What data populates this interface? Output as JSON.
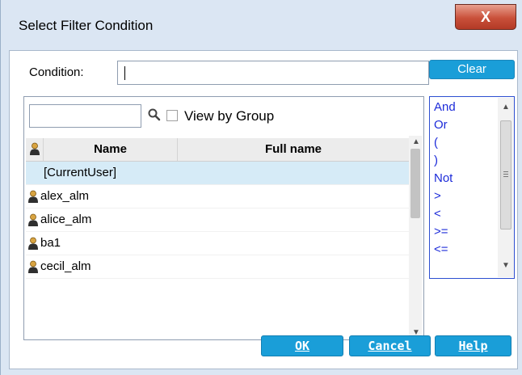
{
  "dialog": {
    "title": "Select Filter Condition",
    "close_glyph": "X"
  },
  "condition": {
    "label": "Condition:",
    "value": "",
    "clear_label": "Clear"
  },
  "users": {
    "search_value": "",
    "view_by_group_label": "View by Group",
    "view_by_group_checked": false,
    "columns": [
      "Name",
      "Full name"
    ],
    "rows": [
      {
        "name": "[CurrentUser]",
        "full_name": "",
        "icon": false,
        "selected": true
      },
      {
        "name": "alex_alm",
        "full_name": "",
        "icon": true,
        "selected": false
      },
      {
        "name": "alice_alm",
        "full_name": "",
        "icon": true,
        "selected": false
      },
      {
        "name": "ba1",
        "full_name": "",
        "icon": true,
        "selected": false
      },
      {
        "name": "cecil_alm",
        "full_name": "",
        "icon": true,
        "selected": false
      }
    ]
  },
  "operators": [
    "And",
    "Or",
    "(",
    ")",
    "Not",
    ">",
    "<",
    ">=",
    "<="
  ],
  "buttons": {
    "ok": "OK",
    "cancel": "Cancel",
    "help": "Help"
  },
  "colors": {
    "accent_button": "#1a9ed8",
    "operator_text": "#1c2bd9",
    "selected_row": "#d6ebf7"
  },
  "icons": {
    "close": "close-icon",
    "search": "search-icon",
    "user": "user-icon"
  }
}
